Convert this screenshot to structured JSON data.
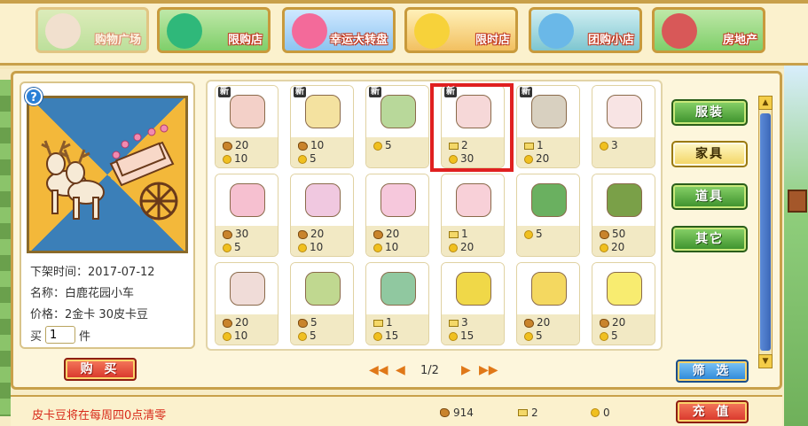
{
  "nav": {
    "tabs": [
      {
        "label": "购物广场",
        "icon": "shop-plaza-icon",
        "state": "dim"
      },
      {
        "label": "限购店",
        "icon": "monster-icon",
        "state": "normal"
      },
      {
        "label": "幸运大转盘",
        "icon": "wheel-icon",
        "state": "normal"
      },
      {
        "label": "限时店",
        "icon": "yellow-pet-icon",
        "state": "active"
      },
      {
        "label": "团购小店",
        "icon": "blue-pet-icon",
        "state": "normal"
      },
      {
        "label": "房地产",
        "icon": "house-icon",
        "state": "normal"
      }
    ]
  },
  "preview": {
    "help": "?",
    "date_label": "下架时间：",
    "date": "2017-07-12",
    "name_label": "名称：",
    "name": "白鹿花园小车",
    "price_label": "价格：",
    "price": "2金卡  30皮卡豆",
    "qty_prefix": "买",
    "qty": "1",
    "qty_suffix": "件",
    "buy_label": "购 买"
  },
  "items": [
    {
      "new": true,
      "pic": "flower-bench-icon",
      "r1": {
        "type": "bean",
        "v": "20"
      },
      "r2": {
        "type": "coin",
        "v": "10"
      }
    },
    {
      "new": true,
      "pic": "lamp-post-icon",
      "r1": {
        "type": "bean",
        "v": "10"
      },
      "r2": {
        "type": "coin",
        "v": "5"
      }
    },
    {
      "new": true,
      "pic": "flower-hedge-icon",
      "r1": {
        "type": "coin",
        "v": "5"
      },
      "r2": null
    },
    {
      "new": true,
      "pic": "deer-head-icon",
      "r1": {
        "type": "card",
        "v": "2"
      },
      "r2": {
        "type": "coin",
        "v": "30"
      }
    },
    {
      "new": true,
      "pic": "vine-arch-icon",
      "r1": {
        "type": "card",
        "v": "1"
      },
      "r2": {
        "type": "coin",
        "v": "20"
      }
    },
    {
      "new": false,
      "pic": "cupcake-lamp-icon",
      "r1": {
        "type": "coin",
        "v": "3"
      },
      "r2": null
    },
    {
      "new": false,
      "pic": "cake-table-icon",
      "r1": {
        "type": "bean",
        "v": "30"
      },
      "r2": {
        "type": "coin",
        "v": "5"
      }
    },
    {
      "new": false,
      "pic": "vanity-icon",
      "r1": {
        "type": "bean",
        "v": "20"
      },
      "r2": {
        "type": "coin",
        "v": "10"
      }
    },
    {
      "new": false,
      "pic": "pink-cabinet-icon",
      "r1": {
        "type": "bean",
        "v": "20"
      },
      "r2": {
        "type": "coin",
        "v": "10"
      }
    },
    {
      "new": false,
      "pic": "cupcake-house-icon",
      "r1": {
        "type": "card",
        "v": "1"
      },
      "r2": {
        "type": "coin",
        "v": "20"
      }
    },
    {
      "new": false,
      "pic": "flower-bed-icon",
      "r1": {
        "type": "coin",
        "v": "5"
      },
      "r2": null
    },
    {
      "new": false,
      "pic": "hedge-fence-icon",
      "r1": {
        "type": "bean",
        "v": "50"
      },
      "r2": {
        "type": "coin",
        "v": "20"
      }
    },
    {
      "new": false,
      "pic": "bunny-sign-icon",
      "r1": {
        "type": "bean",
        "v": "20"
      },
      "r2": {
        "type": "coin",
        "v": "10"
      }
    },
    {
      "new": false,
      "pic": "flower-cart-icon",
      "r1": {
        "type": "bean",
        "v": "5"
      },
      "r2": {
        "type": "coin",
        "v": "5"
      }
    },
    {
      "new": false,
      "pic": "garden-box-icon",
      "r1": {
        "type": "card",
        "v": "1"
      },
      "r2": {
        "type": "coin",
        "v": "15"
      }
    },
    {
      "new": false,
      "pic": "yellow-mailbox-icon",
      "r1": {
        "type": "card",
        "v": "3"
      },
      "r2": {
        "type": "coin",
        "v": "15"
      }
    },
    {
      "new": false,
      "pic": "water-tank-icon",
      "r1": {
        "type": "bean",
        "v": "20"
      },
      "r2": {
        "type": "coin",
        "v": "5"
      }
    },
    {
      "new": false,
      "pic": "lemon-house-icon",
      "r1": {
        "type": "bean",
        "v": "20"
      },
      "r2": {
        "type": "coin",
        "v": "5"
      }
    }
  ],
  "new_tag": "新",
  "categories": [
    {
      "label": "服装",
      "active": false
    },
    {
      "label": "家具",
      "active": true
    },
    {
      "label": "道具",
      "active": false
    },
    {
      "label": "其它",
      "active": false
    }
  ],
  "pager": {
    "first": "◀◀",
    "prev": "◀",
    "text": "1/2",
    "next": "▶",
    "last": "▶▶"
  },
  "filter_label": "筛 选",
  "bottom": {
    "notice": "皮卡豆将在每周四0点清零",
    "beans": "914",
    "cards": "2",
    "coins": "0",
    "recharge_label": "充 值"
  },
  "colors": {
    "highlight": "#e02020",
    "accent": "#c8a04a"
  }
}
